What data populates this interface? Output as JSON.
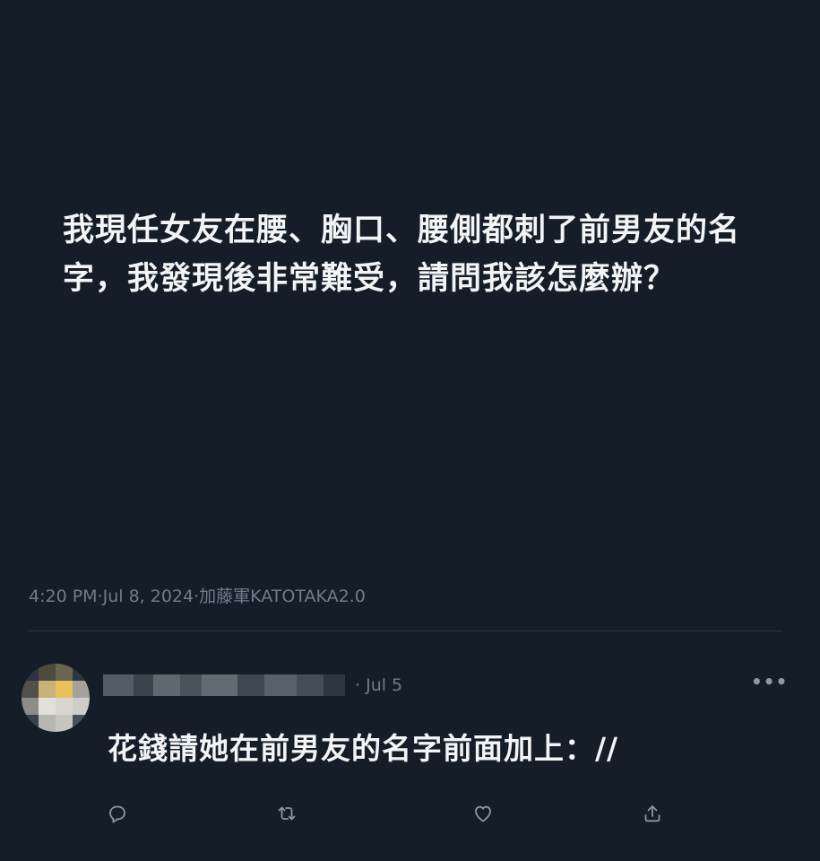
{
  "tweet": {
    "text": "我現任女友在腰、胸口、腰側都刺了前男友的名字，我發現後非常難受，請問我該怎麼辦？",
    "time": "4:20 PM",
    "date": "Jul 8, 2024",
    "source": "加藤軍KATOTAKA2.0",
    "separator": " · "
  },
  "reply": {
    "date_prefix": "· ",
    "date": "Jul 5",
    "text": "花錢請她在前男友的名字前面加上：//",
    "more_label": "•••"
  },
  "actions": [
    {
      "icon": "reply-icon"
    },
    {
      "icon": "retweet-icon"
    },
    {
      "icon": "like-icon"
    },
    {
      "icon": "share-icon"
    }
  ],
  "colors": {
    "background": "#151d29",
    "primary_text": "#f2f4f6",
    "secondary_text": "#6f7c89",
    "divider": "#2c3947"
  }
}
